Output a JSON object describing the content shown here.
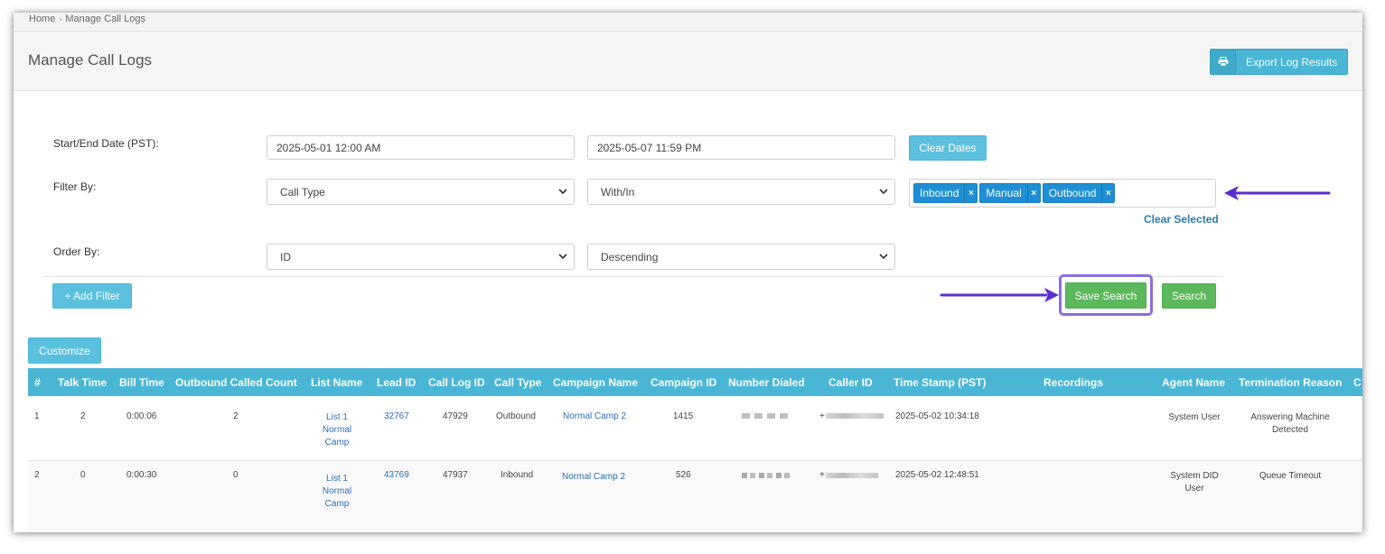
{
  "breadcrumb": {
    "home": "Home",
    "current": "Manage Call Logs"
  },
  "header": {
    "title": "Manage Call Logs",
    "export_label": "Export Log Results"
  },
  "filters": {
    "date_label": "Start/End Date (PST):",
    "start_date": "2025-05-01 12:00 AM",
    "end_date": "2025-05-07 11:59 PM",
    "clear_dates_label": "Clear Dates",
    "filter_by_label": "Filter By:",
    "filter_field": "Call Type",
    "filter_operator": "With/In",
    "selected_values": [
      "Inbound",
      "Manual",
      "Outbound"
    ],
    "tag_remove_symbol": "×",
    "clear_selected_label": "Clear Selected",
    "order_by_label": "Order By:",
    "order_field": "ID",
    "order_direction": "Descending",
    "add_filter_label": "+ Add Filter",
    "save_search_label": "Save Search",
    "search_label": "Search"
  },
  "customize_label": "Customize",
  "table": {
    "headers": [
      "#",
      "Talk Time",
      "Bill Time",
      "Outbound Called Count",
      "List Name",
      "Lead ID",
      "Call Log ID",
      "Call Type",
      "Campaign Name",
      "Campaign ID",
      "Number Dialed",
      "Caller ID",
      "Time Stamp (PST)",
      "Recordings",
      "Agent Name",
      "Termination Reason",
      "C"
    ],
    "rows": [
      {
        "num": "1",
        "talk_time": "2",
        "bill_time": "0:00:06",
        "outbound_count": "2",
        "list_name": [
          "List 1",
          "Normal",
          "Camp"
        ],
        "lead_id": "32767",
        "call_log_id": "47929",
        "call_type": "Outbound",
        "campaign_name": "Normal Camp 2",
        "campaign_id": "1415",
        "caller_id_prefix": "+",
        "timestamp": "2025-05-02 10:34:18",
        "agent_name": [
          "System User"
        ],
        "termination_reason": [
          "Answering Machine",
          "Detected"
        ]
      },
      {
        "num": "2",
        "talk_time": "0",
        "bill_time": "0:00:30",
        "outbound_count": "0",
        "list_name": [
          "List 1",
          "Normal",
          "Camp"
        ],
        "lead_id": "43769",
        "call_log_id": "47937",
        "call_type": "Inbound",
        "campaign_name": "Normal Camp 2",
        "campaign_id": "526",
        "caller_id_prefix": "+",
        "timestamp": "2025-05-02 12:48:51",
        "agent_name": [
          "System DID",
          "User"
        ],
        "termination_reason": [
          "Queue Timeout"
        ]
      }
    ]
  },
  "colors": {
    "info": "#5bc0de",
    "table_header": "#49b6d6",
    "success": "#5cb85c",
    "tag": "#1e8fd6",
    "highlight": "#8b6ee0",
    "arrow": "#5b2ed1"
  }
}
